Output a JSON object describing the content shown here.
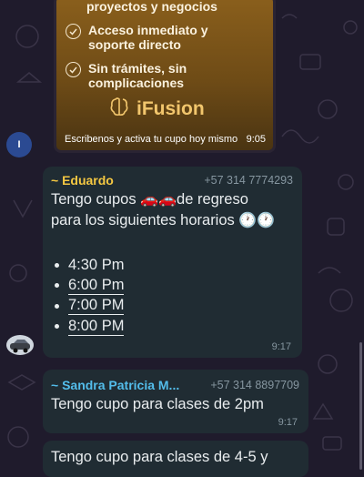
{
  "promo": {
    "items": [
      {
        "text": "proyectos y negocios",
        "icon": "check-circle-icon"
      },
      {
        "text": "Acceso inmediato y soporte directo",
        "icon": "check-circle-icon"
      },
      {
        "text": "Sin trámites, sin complicaciones",
        "icon": "check-circle-icon"
      }
    ],
    "brand": "iFusion",
    "caption": "Escribenos y activa tu cupo hoy mismo",
    "time": "9:05"
  },
  "avatar_initial": "I",
  "messages": [
    {
      "sender": "~ Eduardo",
      "sender_color": "#f5c842",
      "phone": "+57 314 7774293",
      "text_line1": "Tengo cupos",
      "text_line1b": "de regreso",
      "text_line2": "para los siguientes horarios",
      "emoji_cars": "🚗🚗",
      "emoji_clocks": "🕐🕐",
      "times": [
        "4:30 Pm",
        "6:00 Pm",
        "7:00 PM",
        "8:00 PM"
      ],
      "time": "9:17"
    },
    {
      "sender": "~ Sandra Patricia M...",
      "sender_color": "#53bdeb",
      "phone": "+57 314 8897709",
      "text": "Tengo cupo para clases de 2pm",
      "time": "9:17"
    },
    {
      "text": "Tengo cupo para clases de 4-5 y"
    }
  ]
}
